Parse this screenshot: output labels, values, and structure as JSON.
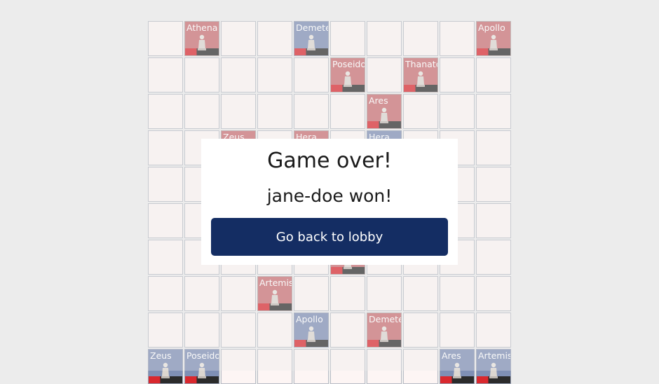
{
  "colors": {
    "red_team": "#c96f73",
    "blue_team": "#7f8fb5",
    "empty_cell": "#fdf5f4",
    "button": "#142d63",
    "background": "#ececec"
  },
  "board": {
    "rows": 10,
    "cols": 10,
    "pieces": [
      {
        "row": 0,
        "col": 1,
        "team": "red",
        "label": "Athena"
      },
      {
        "row": 0,
        "col": 4,
        "team": "blue",
        "label": "Demeter"
      },
      {
        "row": 0,
        "col": 9,
        "team": "red",
        "label": "Apollo"
      },
      {
        "row": 1,
        "col": 5,
        "team": "red",
        "label": "Poseidon"
      },
      {
        "row": 1,
        "col": 7,
        "team": "red",
        "label": "Thanatos"
      },
      {
        "row": 2,
        "col": 6,
        "team": "red",
        "label": "Ares"
      },
      {
        "row": 3,
        "col": 2,
        "team": "red",
        "label": "Zeus"
      },
      {
        "row": 3,
        "col": 4,
        "team": "red",
        "label": "Hera"
      },
      {
        "row": 3,
        "col": 6,
        "team": "blue",
        "label": "Hera"
      },
      {
        "row": 6,
        "col": 5,
        "team": "red",
        "label": ""
      },
      {
        "row": 7,
        "col": 3,
        "team": "red",
        "label": "Artemis"
      },
      {
        "row": 8,
        "col": 4,
        "team": "blue",
        "label": "Apollo"
      },
      {
        "row": 8,
        "col": 6,
        "team": "red",
        "label": "Demeter"
      },
      {
        "row": 9,
        "col": 0,
        "team": "blue",
        "label": "Zeus"
      },
      {
        "row": 9,
        "col": 1,
        "team": "blue",
        "label": "Poseidon"
      },
      {
        "row": 9,
        "col": 8,
        "team": "blue",
        "label": "Ares"
      },
      {
        "row": 9,
        "col": 9,
        "team": "blue",
        "label": "Artemis"
      }
    ]
  },
  "modal": {
    "title": "Game over!",
    "subtitle": "jane-doe won!",
    "button_label": "Go back to lobby"
  }
}
